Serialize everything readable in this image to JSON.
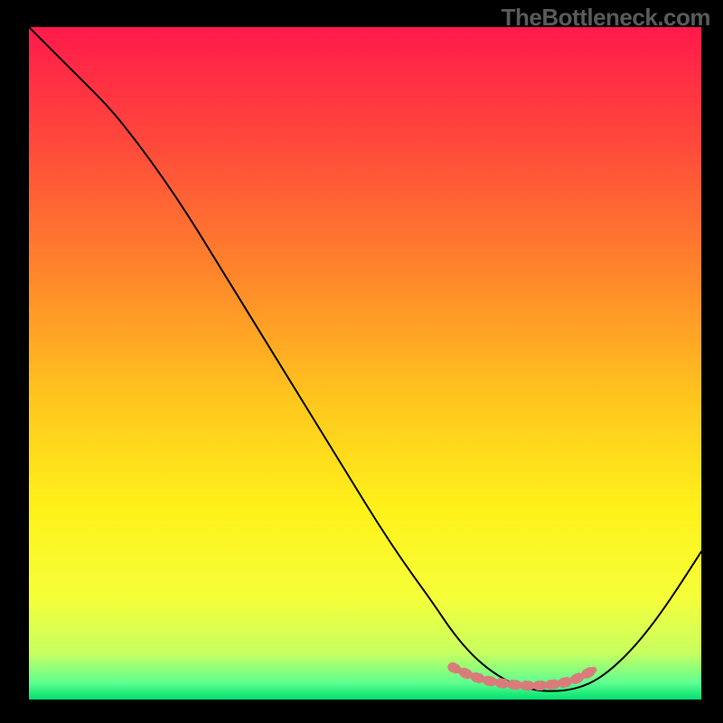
{
  "watermark": "TheBottleneck.com",
  "chart_data": {
    "type": "line",
    "title": "",
    "xlabel": "",
    "ylabel": "",
    "xlim": [
      0,
      100
    ],
    "ylim": [
      0,
      100
    ],
    "grid": false,
    "background_gradient": {
      "type": "vertical-rainbow",
      "stops": [
        {
          "offset": 0.0,
          "color": "#ff1a4b"
        },
        {
          "offset": 0.18,
          "color": "#ff4b3a"
        },
        {
          "offset": 0.38,
          "color": "#ff8a2a"
        },
        {
          "offset": 0.55,
          "color": "#ffc51e"
        },
        {
          "offset": 0.72,
          "color": "#fff21a"
        },
        {
          "offset": 0.85,
          "color": "#f5ff3a"
        },
        {
          "offset": 0.93,
          "color": "#c8ff60"
        },
        {
          "offset": 0.975,
          "color": "#60ff90"
        },
        {
          "offset": 1.0,
          "color": "#00e070"
        }
      ]
    },
    "series": [
      {
        "name": "bottleneck-curve",
        "color": "#000000",
        "width": 2,
        "x": [
          0,
          4,
          8,
          12,
          16,
          20,
          24,
          28,
          32,
          36,
          40,
          44,
          48,
          52,
          56,
          60,
          63,
          66,
          69,
          72,
          75,
          78,
          81,
          84,
          87,
          90,
          93,
          96,
          100
        ],
        "values": [
          100,
          96,
          92,
          88,
          83,
          77.5,
          71.5,
          65,
          58.5,
          52,
          45.5,
          39,
          32.5,
          26,
          20,
          14.5,
          10,
          6.5,
          4,
          2.3,
          1.4,
          1.2,
          1.5,
          2.6,
          4.8,
          7.8,
          11.5,
          15.8,
          22
        ]
      }
    ],
    "highlight_band": {
      "name": "optimal-range",
      "color": "#d97a7a",
      "x": [
        63,
        66,
        69,
        72,
        75,
        78,
        81,
        84
      ],
      "values": [
        4.8,
        3.4,
        2.6,
        2.2,
        2.0,
        2.2,
        2.8,
        4.4
      ]
    }
  }
}
